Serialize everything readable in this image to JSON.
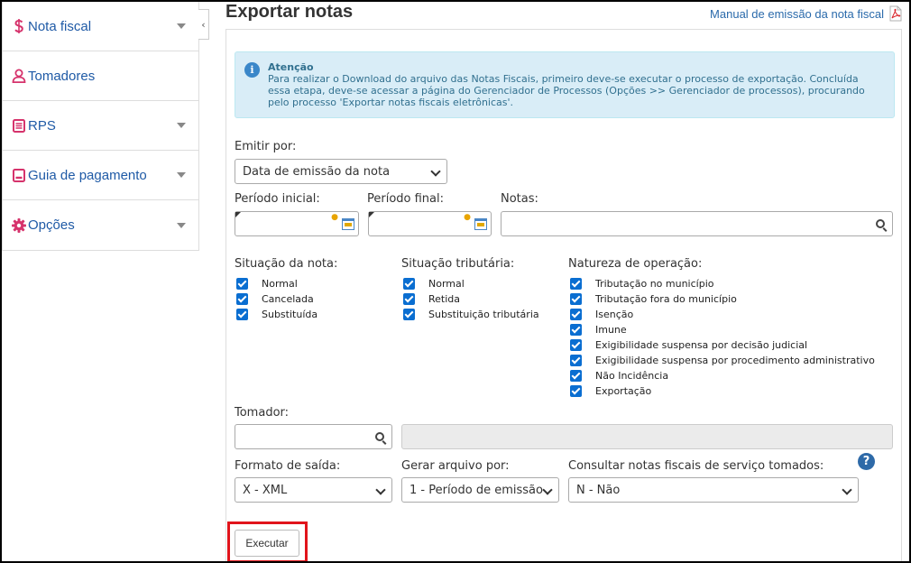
{
  "sidebar": {
    "items": [
      {
        "label": "Nota fiscal",
        "icon": "dollar-icon",
        "expandable": true
      },
      {
        "label": "Tomadores",
        "icon": "user-icon",
        "expandable": false
      },
      {
        "label": "RPS",
        "icon": "list-icon",
        "expandable": true
      },
      {
        "label": "Guia de pagamento",
        "icon": "receipt-icon",
        "expandable": true
      },
      {
        "label": "Opções",
        "icon": "gear-icon",
        "expandable": true
      }
    ],
    "icon_color": "#d6336c",
    "text_color": "#1f5aa6"
  },
  "header": {
    "title": "Exportar notas",
    "manual_link": "Manual de emissão da nota fiscal"
  },
  "alert": {
    "title": "Atenção",
    "text": "Para realizar o Download do arquivo das Notas Fiscais, primeiro deve-se executar o processo de exportação. Concluída essa etapa, deve-se acessar a página do Gerenciador de Processos (Opções >> Gerenciador de processos), procurando pelo processo 'Exportar notas fiscais eletrônicas'."
  },
  "form": {
    "emitir_por": {
      "label": "Emitir por:",
      "value": "Data de emissão da nota"
    },
    "periodo_inicial": {
      "label": "Período inicial:",
      "value": ""
    },
    "periodo_final": {
      "label": "Período final:",
      "value": ""
    },
    "notas": {
      "label": "Notas:",
      "value": ""
    },
    "situacao_nota": {
      "label": "Situação da nota:",
      "options": [
        {
          "label": "Normal",
          "checked": true
        },
        {
          "label": "Cancelada",
          "checked": true
        },
        {
          "label": "Substituída",
          "checked": true
        }
      ]
    },
    "situacao_tributaria": {
      "label": "Situação tributária:",
      "options": [
        {
          "label": "Normal",
          "checked": true
        },
        {
          "label": "Retida",
          "checked": true
        },
        {
          "label": "Substituição tributária",
          "checked": true
        }
      ]
    },
    "natureza_operacao": {
      "label": "Natureza de operação:",
      "options": [
        {
          "label": "Tributação no município",
          "checked": true
        },
        {
          "label": "Tributação fora do município",
          "checked": true
        },
        {
          "label": "Isenção",
          "checked": true
        },
        {
          "label": "Imune",
          "checked": true
        },
        {
          "label": "Exigibilidade suspensa por decisão judicial",
          "checked": true
        },
        {
          "label": "Exigibilidade suspensa por procedimento administrativo",
          "checked": true
        },
        {
          "label": "Não Incidência",
          "checked": true
        },
        {
          "label": "Exportação",
          "checked": true
        }
      ]
    },
    "tomador": {
      "label": "Tomador:",
      "value": ""
    },
    "formato_saida": {
      "label": "Formato de saída:",
      "value": "X - XML"
    },
    "gerar_arquivo": {
      "label": "Gerar arquivo por:",
      "value": "1 - Período de emissão"
    },
    "consultar_tomados": {
      "label": "Consultar notas fiscais de serviço tomados:",
      "value": "N - Não"
    },
    "help_symbol": "?",
    "execute_label": "Executar"
  },
  "colors": {
    "checkbox": "#0a6ed1",
    "alert_bg": "#d9edf7",
    "highlight": "#e1141b"
  }
}
